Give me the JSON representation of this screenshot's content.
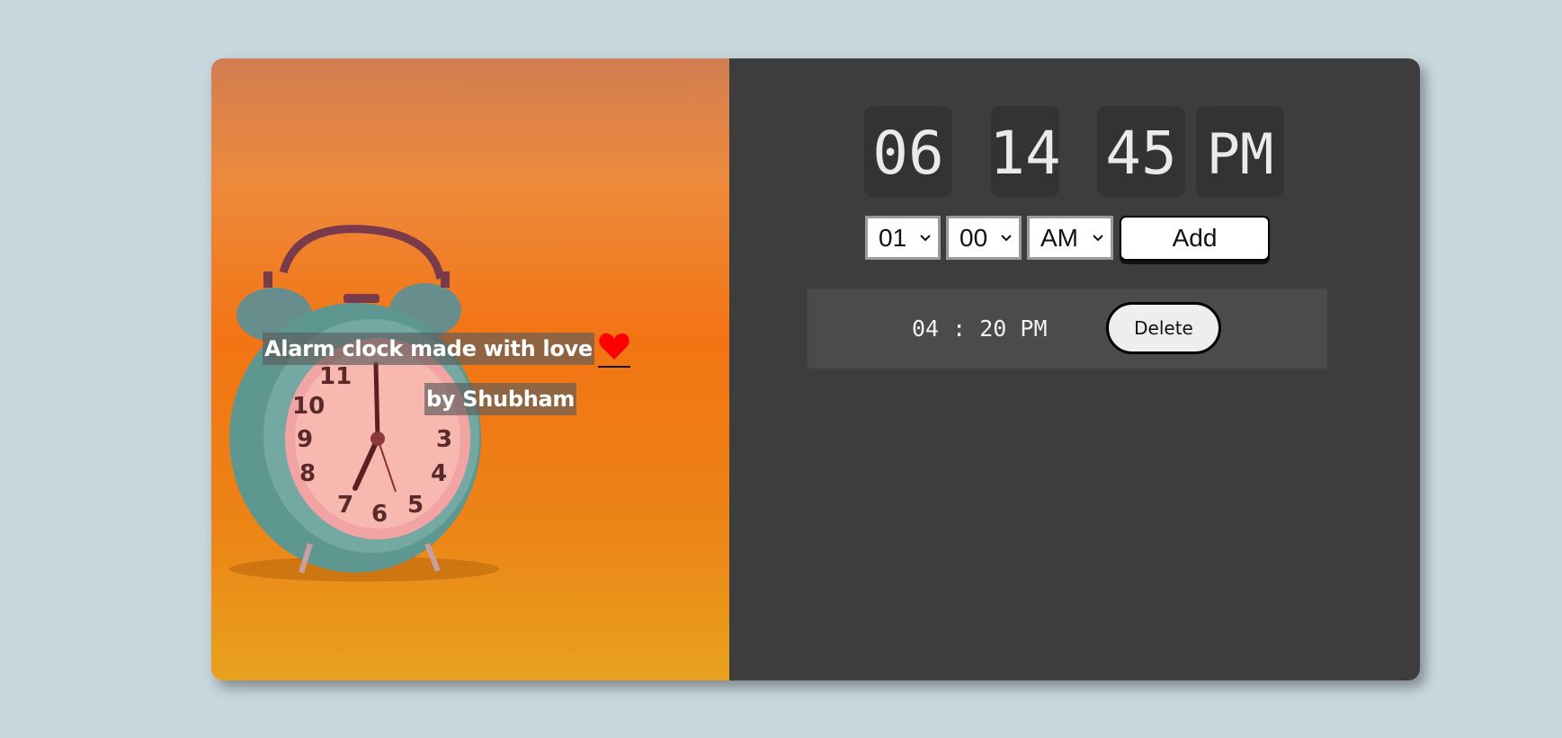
{
  "caption": {
    "line1": "Alarm clock made with love",
    "line2": "by Shubham",
    "heart_icon": "heart-icon",
    "heart_color": "#ff0000"
  },
  "display": {
    "hours": "06",
    "minutes": "14",
    "seconds": "45",
    "ampm": "PM"
  },
  "alarm_form": {
    "hour_selected": "01",
    "minute_selected": "00",
    "ampm_selected": "AM",
    "add_label": "Add"
  },
  "alarms": [
    {
      "time": "04 : 20 PM",
      "delete_label": "Delete"
    }
  ],
  "colors": {
    "page_bg": "#c8d7de",
    "panel_bg": "#3d3d3d",
    "digit_bg": "#333333",
    "alarm_row_bg": "#4c4b4b"
  }
}
